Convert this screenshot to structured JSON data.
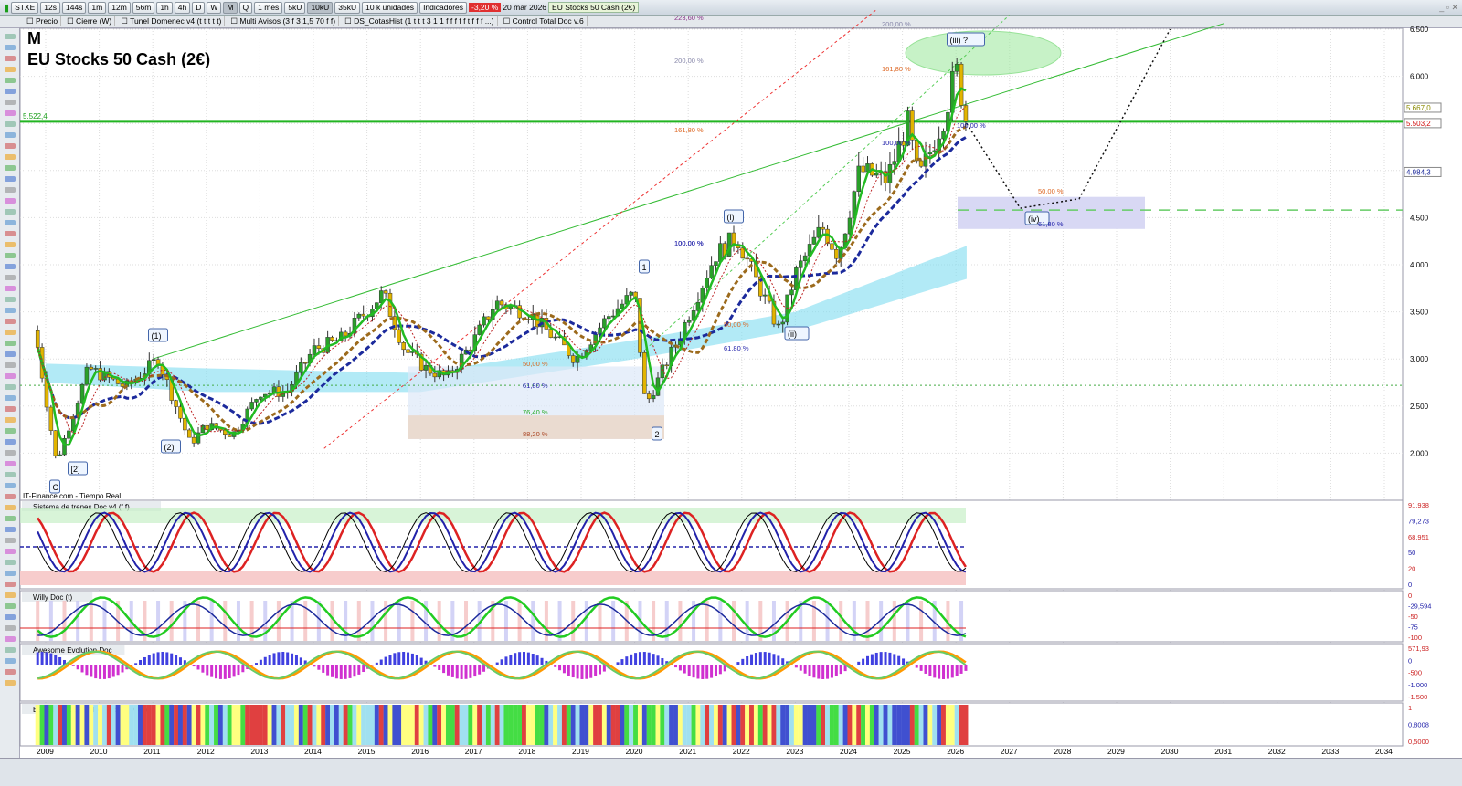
{
  "toolbar": {
    "symbol": "STXE",
    "intervals": [
      "12s",
      "144s",
      "1m",
      "12m",
      "56m",
      "1h",
      "4h",
      "D",
      "W",
      "M",
      "Q"
    ],
    "active_interval": "M",
    "period": "1 mes",
    "units": [
      "5kU",
      "10kU",
      "35kU"
    ],
    "units_select": "10 k unidades",
    "indicators": "Indicadores",
    "change": "-3,20 %",
    "date": "20 mar 2026",
    "instrument": "EU Stocks 50 Cash (2€)"
  },
  "legend_bar": [
    "Precio",
    "Cierre (W)",
    "Tunel Domenec v4 (t t t t t)",
    "Multi Avisos (3 f 3 1,5 70 f f)",
    "DS_CotasHist (1 t t t 3 1 1 f f f f f t f f f ...)",
    "Control Total Doc v.6"
  ],
  "header": {
    "timeframe": "M",
    "title": "EU Stocks 50 Cash (2€)",
    "level_label": "5.522,4",
    "source": "IT-Finance.com - Tiempo Real"
  },
  "colors": {
    "up": "#1a9e1a",
    "down": "#d01010",
    "support": "#22b522",
    "ma_blue": "#1c2a9c",
    "ma_brown": "#9c6a1c",
    "cloud": "#7fdcf0"
  },
  "price_axis": {
    "ticks": [
      "6.500",
      "6.000",
      "4.500",
      "4.000",
      "3.500",
      "3.000",
      "2.500",
      "2.000"
    ],
    "tags": [
      {
        "text": "5.667,0",
        "color": "#8a8a00"
      },
      {
        "text": "5.503,2",
        "color": "#d01010"
      },
      {
        "text": "4.984,3",
        "color": "#1c2a9c"
      }
    ]
  },
  "waves": [
    "(1)",
    "(2)",
    "(i)",
    "(ii)",
    "(iii) ?",
    "(iv)",
    "1",
    "2",
    "C",
    "[2]"
  ],
  "fibs": [
    "223,60 %",
    "200,00 %",
    "200,00 %",
    "161,80 %",
    "161,80 %",
    "100,00 %",
    "100,00 %",
    "100,00 %",
    "100,00 %",
    "50,00 %",
    "61,80 %",
    "50,00 %",
    "61,80 %",
    "76,40 %",
    "88,20 %",
    "50,00 %",
    "61,80 %"
  ],
  "panels": [
    {
      "title": "Sistema de trenes Doc v4 (f f)",
      "tags": [
        "91,938",
        "79,273",
        "68,951",
        "50",
        "20",
        "0"
      ]
    },
    {
      "title": "Willy Doc (t)",
      "tags": [
        "0",
        "-29,594",
        "-50",
        "-75",
        "-100"
      ]
    },
    {
      "title": "Awesome Evolution Doc",
      "tags": [
        "571,93",
        "0",
        "-500",
        "-1.000",
        "-1.500"
      ]
    },
    {
      "title": "Barra Fuerza Fondo Mercado v4 (f)",
      "tags": [
        "1",
        "0,8008",
        "0,5000"
      ]
    }
  ],
  "chart_data": {
    "type": "candlestick",
    "title": "EU Stocks 50 Cash (2€)",
    "timeframe": "monthly",
    "xlabel": "",
    "ylabel": "",
    "x_ticks": [
      "2009",
      "2010",
      "2011",
      "2012",
      "2013",
      "2014",
      "2015",
      "2016",
      "2017",
      "2018",
      "2019",
      "2020",
      "2021",
      "2022",
      "2023",
      "2024",
      "2025",
      "2026",
      "2027",
      "2028",
      "2029",
      "2030",
      "2031",
      "2032",
      "2033",
      "2034"
    ],
    "ylim": [
      1700,
      6600
    ],
    "price_path": [
      [
        2008.8,
        3300
      ],
      [
        2009.2,
        1900
      ],
      [
        2009.8,
        2900
      ],
      [
        2010.5,
        2700
      ],
      [
        2011.1,
        3000
      ],
      [
        2011.7,
        2100
      ],
      [
        2012.0,
        2300
      ],
      [
        2012.5,
        2200
      ],
      [
        2013.0,
        2650
      ],
      [
        2013.5,
        2650
      ],
      [
        2014.0,
        3100
      ],
      [
        2014.5,
        3200
      ],
      [
        2015.3,
        3700
      ],
      [
        2015.7,
        3100
      ],
      [
        2016.1,
        2900
      ],
      [
        2016.5,
        2800
      ],
      [
        2017.0,
        3200
      ],
      [
        2017.4,
        3600
      ],
      [
        2018.0,
        3500
      ],
      [
        2018.9,
        3000
      ],
      [
        2019.5,
        3450
      ],
      [
        2020.0,
        3700
      ],
      [
        2020.2,
        2500
      ],
      [
        2020.8,
        3200
      ],
      [
        2021.5,
        4100
      ],
      [
        2021.9,
        4300
      ],
      [
        2022.7,
        3300
      ],
      [
        2023.0,
        3900
      ],
      [
        2023.5,
        4400
      ],
      [
        2023.8,
        4100
      ],
      [
        2024.2,
        5000
      ],
      [
        2024.7,
        4900
      ],
      [
        2025.1,
        5500
      ],
      [
        2025.3,
        4900
      ],
      [
        2025.8,
        5600
      ],
      [
        2026.0,
        6100
      ],
      [
        2026.2,
        5500
      ]
    ],
    "horizontal_levels": [
      5522.4,
      4580,
      2720
    ],
    "projection": [
      [
        2026.2,
        5500
      ],
      [
        2027.2,
        4600
      ],
      [
        2028.3,
        4700
      ],
      [
        2030.0,
        6500
      ]
    ]
  }
}
